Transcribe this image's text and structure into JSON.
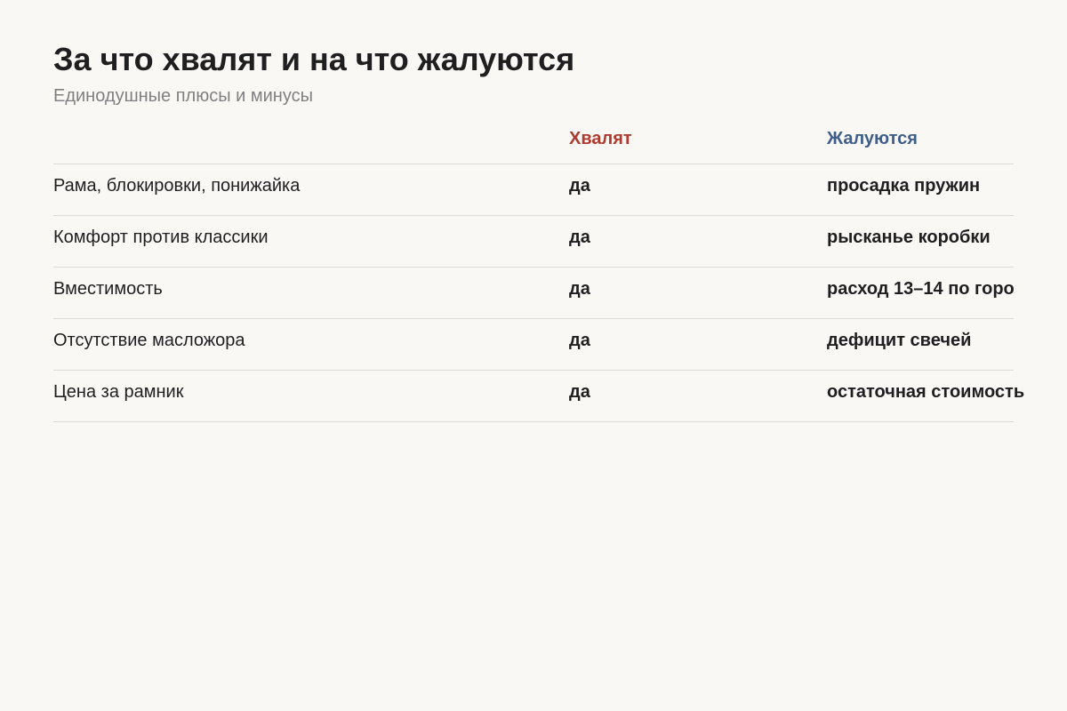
{
  "title": "За что хвалят и на что жалуются",
  "subtitle": "Единодушные плюсы и минусы",
  "colors": {
    "praise_header": "#b03a2e",
    "complaint_header": "#3f5f8a",
    "background": "#faf8f5",
    "divider": "#dedcd8"
  },
  "table": {
    "headers": {
      "topic": "",
      "praise": "Хвалят",
      "complaint": "Жалуются"
    },
    "rows": [
      {
        "topic": "Рама, блокировки, понижайка",
        "praise": "да",
        "complaint": "просадка пружин"
      },
      {
        "topic": "Комфорт против классики",
        "praise": "да",
        "complaint": "рысканье коробки"
      },
      {
        "topic": "Вместимость",
        "praise": "да",
        "complaint": "расход 13–14 по горо"
      },
      {
        "topic": "Отсутствие масложора",
        "praise": "да",
        "complaint": "дефицит свечей"
      },
      {
        "topic": "Цена за рамник",
        "praise": "да",
        "complaint": "остаточная стоимость"
      }
    ]
  }
}
